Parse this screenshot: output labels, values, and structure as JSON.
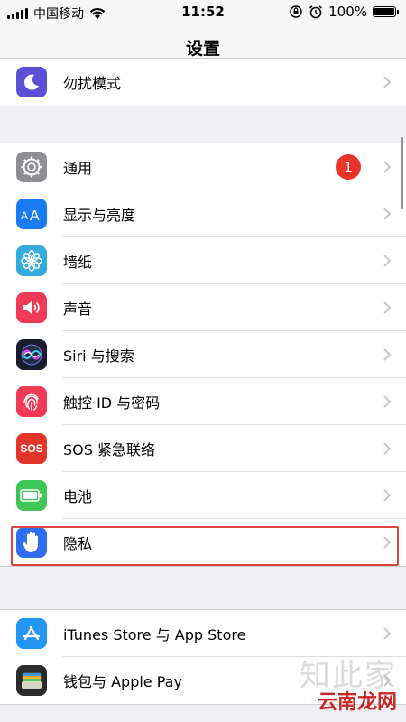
{
  "status_bar": {
    "carrier": "中国移动",
    "time": "11:52",
    "battery": "100%",
    "battery_level": 1.0
  },
  "nav": {
    "title": "设置"
  },
  "groups": [
    {
      "rows": [
        {
          "label": "勿扰模式",
          "icon": "moon-icon",
          "color": "#5b50d6"
        }
      ]
    },
    {
      "rows": [
        {
          "label": "通用",
          "icon": "gear-icon",
          "color": "#8e8e93",
          "badge": "1"
        },
        {
          "label": "显示与亮度",
          "icon": "text-size-icon",
          "color": "#1a7cf2"
        },
        {
          "label": "墙纸",
          "icon": "flower-icon",
          "color": "#35aadc"
        },
        {
          "label": "声音",
          "icon": "speaker-icon",
          "color": "#ef3b57"
        },
        {
          "label": "Siri 与搜索",
          "icon": "siri-icon",
          "color": "#1b1b2f"
        },
        {
          "label": "触控 ID 与密码",
          "icon": "fingerprint-icon",
          "color": "#ef3b57"
        },
        {
          "label": "SOS 紧急联络",
          "icon": "sos-icon",
          "color": "#e3352c",
          "icon_text": "SOS"
        },
        {
          "label": "电池",
          "icon": "battery-icon",
          "color": "#3fc55a"
        },
        {
          "label": "隐私",
          "icon": "hand-icon",
          "color": "#2f6ef0"
        }
      ]
    },
    {
      "rows": [
        {
          "label": "iTunes Store 与 App Store",
          "icon": "app-store-icon",
          "color": "#2396f3"
        },
        {
          "label": "钱包与 Apple Pay",
          "icon": "wallet-icon",
          "color": "#2b2b2b"
        }
      ]
    }
  ],
  "watermark": {
    "top": "知此家",
    "bottom": "云南龙网"
  }
}
